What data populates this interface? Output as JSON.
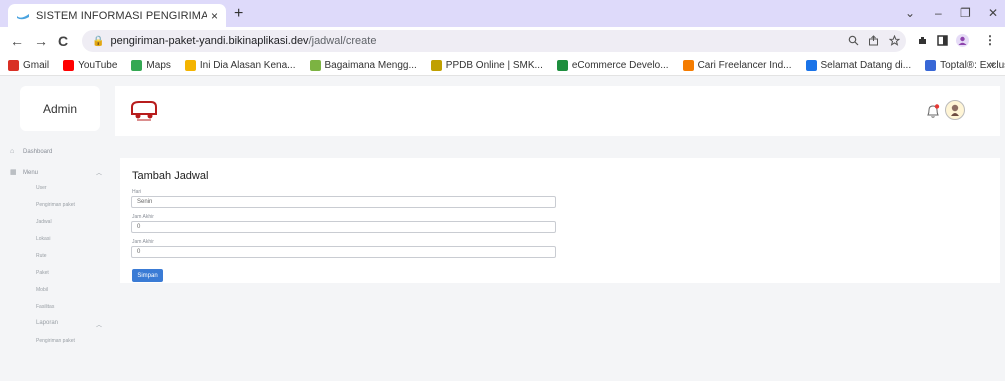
{
  "browser": {
    "tab_title": "SISTEM INFORMASI PENGIRIMA‌",
    "tab_close": "×",
    "new_tab": "+",
    "url_host": "pengiriman-paket-yandi.bikinaplikasi.dev",
    "url_path": "/jadwal/create",
    "window_controls": {
      "minimize": "–",
      "maximize": "❐",
      "close": "✕",
      "dropdown": "⌄"
    },
    "nav": {
      "back": "←",
      "forward": "→",
      "reload": "C"
    },
    "bookmarks": [
      {
        "label": "Gmail",
        "color": "#d93025"
      },
      {
        "label": "YouTube",
        "color": "#ff0000"
      },
      {
        "label": "Maps",
        "color": "#34a853"
      },
      {
        "label": "Ini Dia Alasan Kena...",
        "color": "#f4b400"
      },
      {
        "label": "Bagaimana Mengg...",
        "color": "#7cb342"
      },
      {
        "label": "PPDB Online | SMK...",
        "color": "#c0a000"
      },
      {
        "label": "eCommerce Develo...",
        "color": "#1e8e3e"
      },
      {
        "label": "Cari Freelancer Ind...",
        "color": "#f57c00"
      },
      {
        "label": "Selamat Datang di...",
        "color": "#1a73e8"
      },
      {
        "label": "Toptal®: Exclusive...",
        "color": "#3867d6"
      }
    ],
    "bookmarks_more": "»"
  },
  "app": {
    "admin_label": "Admin",
    "sidebar": {
      "dashboard": "Dashboard",
      "menu": "Menu",
      "menu_items": [
        "User",
        "Pengiriman paket",
        "Jadwal",
        "Lokasi",
        "Rute",
        "Paket",
        "Mobil",
        "Fasilitas"
      ],
      "laporan": "Laporan",
      "laporan_items": [
        "Pengiriman paket"
      ]
    },
    "form": {
      "title": "Tambah Jadwal",
      "fields": [
        {
          "label": "Hari",
          "value": "Senin"
        },
        {
          "label": "Jam Akhir",
          "value": "0"
        },
        {
          "label": "Jam Akhir",
          "value": "0"
        }
      ],
      "submit_label": "Simpan"
    },
    "colors": {
      "accent": "#3a7bd5",
      "notification": "#e53935"
    }
  }
}
